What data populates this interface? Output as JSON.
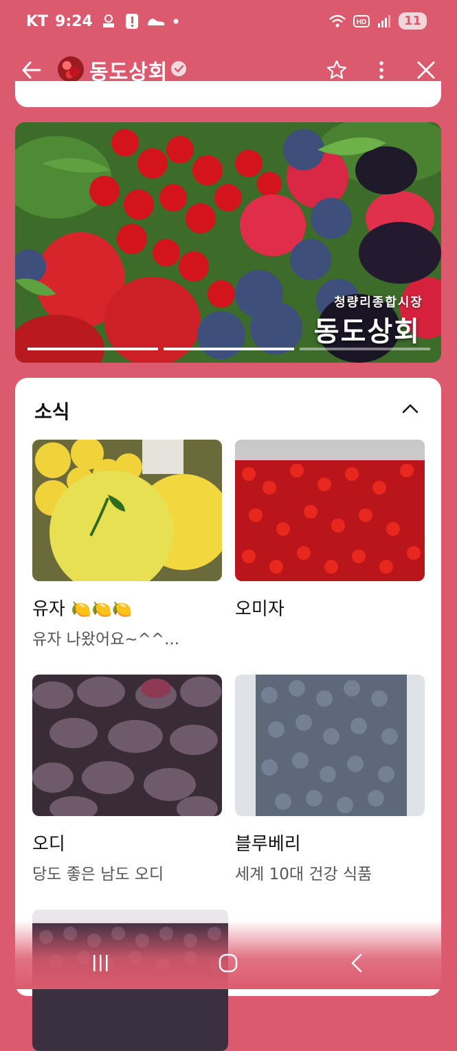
{
  "status_bar": {
    "carrier": "KT",
    "time": "9:24",
    "battery": "11",
    "icons": [
      "bank-icon",
      "alert-icon",
      "sneaker-icon",
      "dot-icon",
      "wifi-icon",
      "hd-icon",
      "signal-icon"
    ]
  },
  "header": {
    "store_name": "동도상회"
  },
  "banner": {
    "subtitle": "청량리종합시장",
    "title": "동도상회",
    "pages": 3,
    "active_page": 2
  },
  "news": {
    "title": "소식",
    "items": [
      {
        "name": "유자",
        "desc": "유자 나왔어요~^^..."
      },
      {
        "name": "오미자",
        "desc": ""
      },
      {
        "name": "오디",
        "desc": "당도 좋은 남도 오디"
      },
      {
        "name": "블루베리",
        "desc": "세계 10대 건강 식품"
      }
    ]
  },
  "colors": {
    "background": "#dc5a6e",
    "card": "#ffffff"
  }
}
